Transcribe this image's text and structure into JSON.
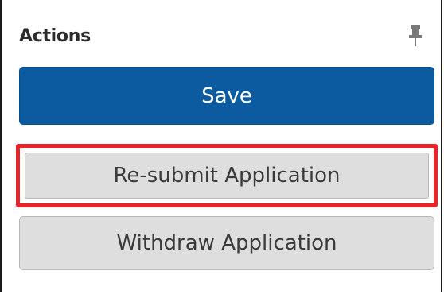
{
  "actions_panel": {
    "title": "Actions",
    "pin_icon": "pin-icon",
    "save_label": "Save",
    "resubmit_label": "Re-submit Application",
    "withdraw_label": "Withdraw Application"
  },
  "colors": {
    "primary": "#0c5aa0",
    "secondary_button": "#dedede",
    "highlight": "#e8232a"
  }
}
